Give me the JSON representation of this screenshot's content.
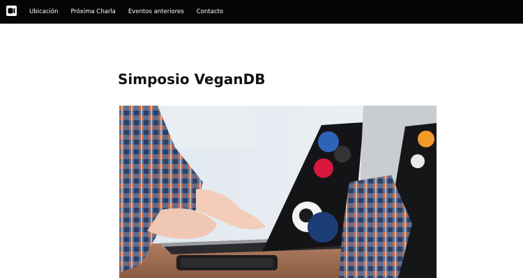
{
  "nav": {
    "logo_icon": "database-logo-icon",
    "items": [
      {
        "label": "Ubicación"
      },
      {
        "label": "Próxima Charla"
      },
      {
        "label": "Eventos anteriores"
      },
      {
        "label": "Contacto"
      }
    ]
  },
  "main": {
    "title": "Simposio VeganDB",
    "hero_image": "photo-person-using-laptop-with-stickers"
  },
  "colors": {
    "navbar_bg": "#030604",
    "nav_text": "#ffffff",
    "title_text": "#111111",
    "page_bg": "#ffffff"
  }
}
